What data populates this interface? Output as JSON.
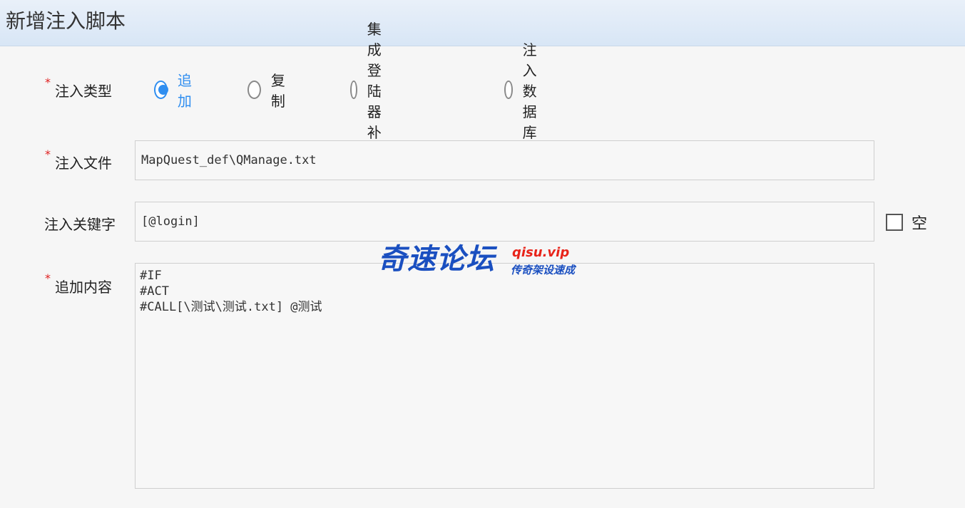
{
  "window": {
    "title": "新增注入脚本"
  },
  "form": {
    "inject_type": {
      "label": "注入类型",
      "required": "*",
      "options": [
        {
          "label": "追加",
          "checked": true
        },
        {
          "label": "复制",
          "checked": false
        },
        {
          "label": "集成登陆器补丁",
          "checked": false
        },
        {
          "label": "注入数据库",
          "checked": false
        }
      ]
    },
    "inject_file": {
      "label": "注入文件",
      "required": "*",
      "value": "MapQuest_def\\QManage.txt"
    },
    "inject_keyword": {
      "label": "注入关键字",
      "value": "[@login]",
      "empty_checkbox": {
        "label": "空",
        "checked": false
      }
    },
    "append_content": {
      "label": "追加内容",
      "required": "*",
      "value": "#IF\n#ACT\n#CALL[\\测试\\测试.txt] @测试"
    }
  },
  "watermark": {
    "main": "奇速论坛",
    "site": "qisu.vip",
    "sub": "传奇架设速成"
  },
  "colors": {
    "accent": "#2f8ef0",
    "required": "#e02020",
    "titlebar": "#dce8f7"
  }
}
